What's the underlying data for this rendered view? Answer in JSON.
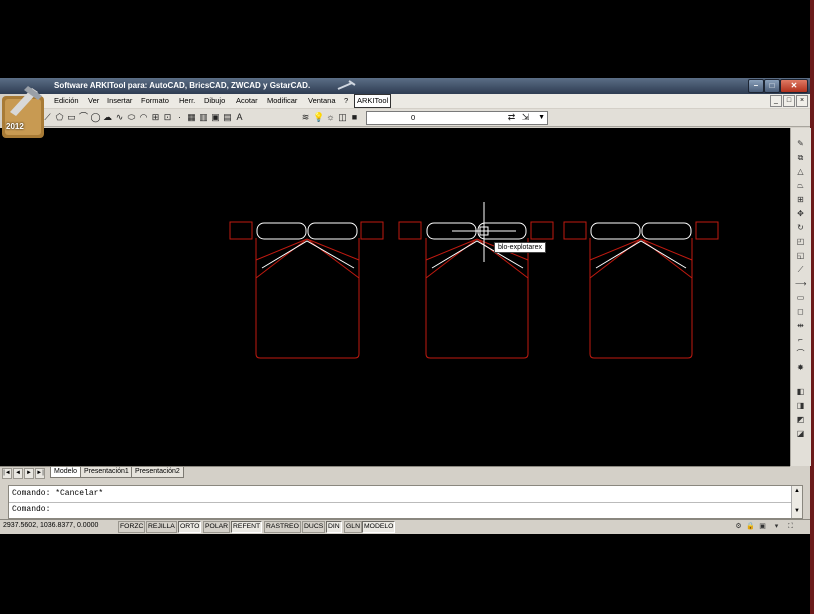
{
  "window": {
    "title": "Software ARKITool para: AutoCAD, BricsCAD, ZWCAD y GstarCAD.",
    "controls": [
      "–",
      "□",
      "✕"
    ]
  },
  "logo": {
    "year": "2012"
  },
  "menu": {
    "items": [
      "Edición",
      "Ver",
      "Insertar",
      "Formato",
      "Herr.",
      "Dibujo",
      "Acotar",
      "Modificar",
      "Ventana",
      "?",
      "ARKITool"
    ],
    "mdi_controls": [
      "_",
      "□",
      "×"
    ]
  },
  "toolbar": {
    "layer_value": "0"
  },
  "drawing": {
    "tooltip": "blo-explotarex",
    "colors": {
      "bed": "#c01a10",
      "pillow": "#ffffff",
      "cursor": "#ffffff"
    }
  },
  "tabs": {
    "nav": [
      "|◄",
      "◄",
      "►",
      "►|"
    ],
    "items": [
      "Modelo",
      "Presentación1",
      "Presentación2"
    ]
  },
  "command": {
    "history": "Comando: *Cancelar*",
    "prompt": "Comando:"
  },
  "status": {
    "coords": "2937.5602, 1036.8377, 0.0000",
    "buttons": [
      "FORZC",
      "REJILLA",
      "ORTO",
      "POLAR",
      "REFENT",
      "RASTREO",
      "DUCS",
      "DIN",
      "GLN",
      "MODELO"
    ]
  }
}
